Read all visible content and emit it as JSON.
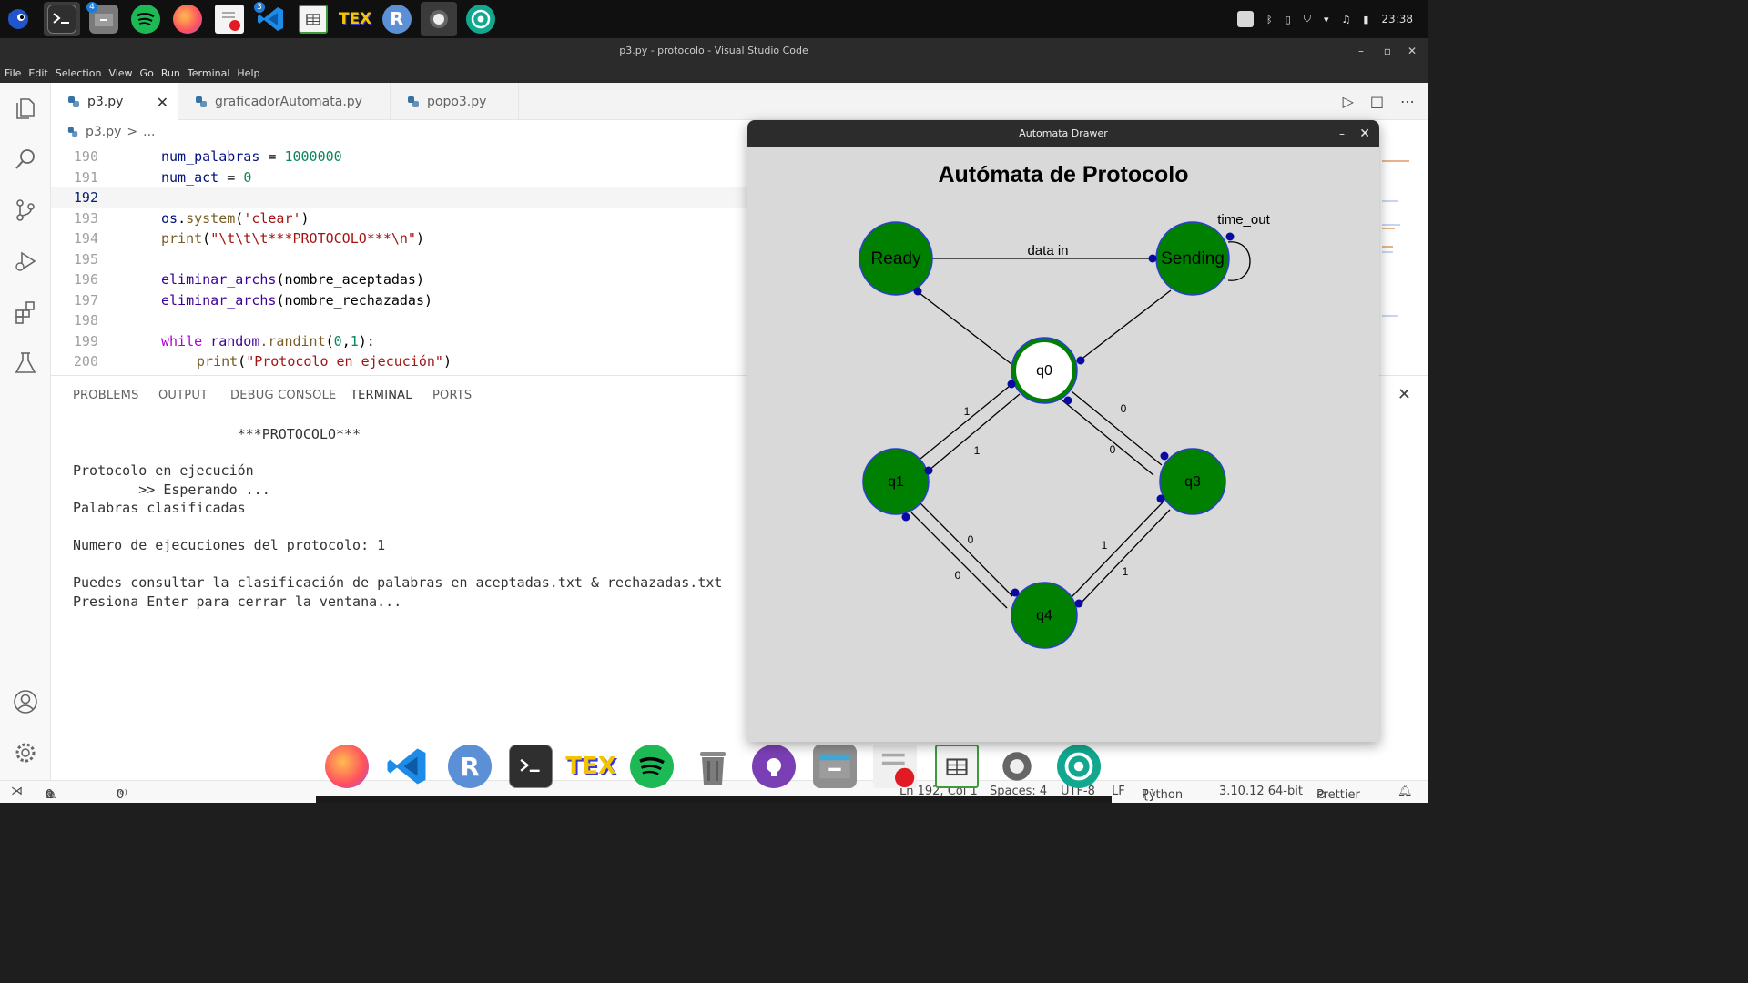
{
  "os": {
    "clock": "23:38",
    "apps": [
      {
        "name": "sonic-icon"
      },
      {
        "name": "terminal-icon"
      },
      {
        "name": "files-icon",
        "badge": "4"
      },
      {
        "name": "spotify-icon"
      },
      {
        "name": "firefox-icon"
      },
      {
        "name": "text-editor-icon"
      },
      {
        "name": "vscode-icon",
        "badge": "3"
      },
      {
        "name": "spreadsheet-icon"
      },
      {
        "name": "tex-icon",
        "label": "TEX"
      },
      {
        "name": "r-icon",
        "label": "R"
      },
      {
        "name": "settings-icon"
      },
      {
        "name": "aperture-icon"
      }
    ]
  },
  "window": {
    "title": "p3.py - protocolo - Visual Studio Code"
  },
  "menu": [
    "File",
    "Edit",
    "Selection",
    "View",
    "Go",
    "Run",
    "Terminal",
    "Help"
  ],
  "tabs": [
    {
      "label": "p3.py",
      "active": true
    },
    {
      "label": "graficadorAutomata.py",
      "active": false
    },
    {
      "label": "popo3.py",
      "active": false
    }
  ],
  "breadcrumb": {
    "file": "p3.py",
    "sep": ">",
    "rest": "..."
  },
  "editor": {
    "lines": [
      {
        "n": "190"
      },
      {
        "n": "191"
      },
      {
        "n": "192"
      },
      {
        "n": "193"
      },
      {
        "n": "194"
      },
      {
        "n": "195"
      },
      {
        "n": "196"
      },
      {
        "n": "197"
      },
      {
        "n": "198"
      },
      {
        "n": "199"
      },
      {
        "n": "200"
      }
    ],
    "code": {
      "l190_var": "num_palabras",
      "l190_op": " = ",
      "l190_num": "1000000",
      "l191_var": "num_act",
      "l191_op": " = ",
      "l191_num": "0",
      "l193_a": "os",
      "l193_b": ".",
      "l193_c": "system",
      "l193_d": "(",
      "l193_e": "'clear'",
      "l193_f": ")",
      "l194_a": "print",
      "l194_b": "(",
      "l194_c": "\"\\t\\t\\t***PROTOCOLO***\\n\"",
      "l194_d": ")",
      "l196_a": "eliminar_archs",
      "l196_b": "(nombre_aceptadas)",
      "l197_a": "eliminar_archs",
      "l197_b": "(nombre_rechazadas)",
      "l199_a": "while",
      "l199_b": " random",
      "l199_c": ".randint",
      "l199_d": "(",
      "l199_e": "0",
      "l199_f": ",",
      "l199_g": "1",
      "l199_h": "):",
      "l200_a": "print",
      "l200_b": "(",
      "l200_c": "\"Protocolo en ejecución\"",
      "l200_d": ")"
    }
  },
  "panel": {
    "tabs": [
      "PROBLEMS",
      "OUTPUT",
      "DEBUG CONSOLE",
      "TERMINAL",
      "PORTS"
    ],
    "active_tab": "TERMINAL",
    "terminal": [
      "                    ***PROTOCOLO***",
      "",
      "Protocolo en ejecución",
      "        >> Esperando ...",
      "Palabras clasificadas",
      "",
      "Numero de ejecuciones del protocolo: 1",
      "",
      "Puedes consultar la clasificación de palabras en aceptadas.txt & rechazadas.txt",
      "Presiona Enter para cerrar la ventana..."
    ]
  },
  "status": {
    "errors": "0",
    "warnings": "0",
    "ports": "0",
    "position": "Ln 192, Col 1",
    "spaces": "Spaces: 4",
    "encoding": "UTF-8",
    "eol": "LF",
    "language": "Python",
    "interpreter": "3.10.12 64-bit",
    "formatter": "Prettier"
  },
  "automata": {
    "window_title": "Automata Drawer",
    "heading": "Autómata de Protocolo",
    "colors": {
      "state_fill": "#008000",
      "state_border": "#2a3fd0",
      "initial_fill": "#ffffff",
      "edge": "#000000",
      "arrowhead": "#0a0aa0",
      "background": "#d9d9d9"
    },
    "states": [
      {
        "id": "Ready",
        "label": "Ready"
      },
      {
        "id": "Sending",
        "label": "Sending"
      },
      {
        "id": "q0",
        "label": "q0",
        "initial": true
      },
      {
        "id": "q1",
        "label": "q1"
      },
      {
        "id": "q3",
        "label": "q3"
      },
      {
        "id": "q4",
        "label": "q4"
      }
    ],
    "edge_labels": {
      "ready_sending": "data in",
      "sending_self": "time_out",
      "q0_q1_a": "1",
      "q0_q1_b": "1",
      "q0_q3_a": "0",
      "q0_q3_b": "0",
      "q1_q4_a": "0",
      "q1_q4_b": "0",
      "q3_q4_a": "1",
      "q3_q4_b": "1"
    }
  },
  "dock": [
    {
      "name": "firefox-icon"
    },
    {
      "name": "vscode-icon"
    },
    {
      "name": "r-icon",
      "label": "R"
    },
    {
      "name": "terminal-icon"
    },
    {
      "name": "tex-icon",
      "label": "TEX"
    },
    {
      "name": "spotify-icon"
    },
    {
      "name": "trash-icon"
    },
    {
      "name": "github-icon"
    },
    {
      "name": "files-icon"
    },
    {
      "name": "text-editor-icon"
    },
    {
      "name": "spreadsheet-icon"
    },
    {
      "name": "settings-icon"
    },
    {
      "name": "aperture-icon"
    }
  ]
}
